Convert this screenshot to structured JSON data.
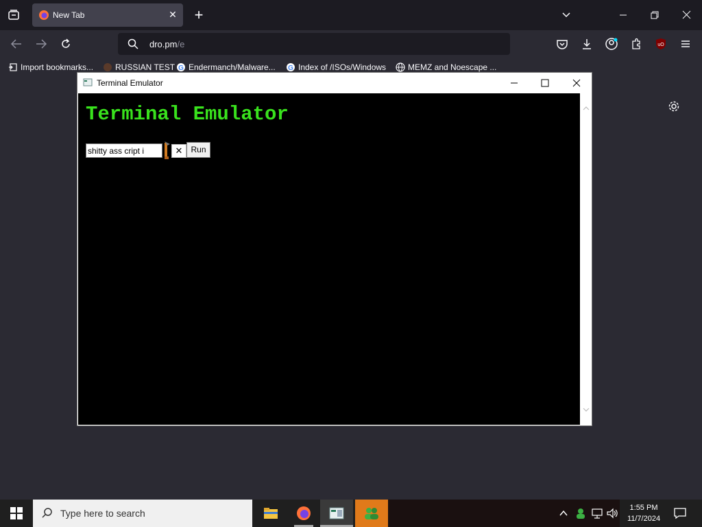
{
  "browser": {
    "tab_title": "New Tab",
    "url_main": "dro.pm",
    "url_suffix": "/e",
    "bookmarks": [
      {
        "label": "Import bookmarks..."
      },
      {
        "label": "RUSSIAN TEST"
      },
      {
        "label": "Endermanch/Malware..."
      },
      {
        "label": "Index of /ISOs/Windows"
      },
      {
        "label": "MEMZ and Noescape ..."
      }
    ]
  },
  "terminal": {
    "window_title": "Terminal Emulator",
    "heading": "Terminal Emulator",
    "input_value": "shitty ass cript i",
    "clear_label": "✕",
    "run_label": "Run"
  },
  "taskbar": {
    "search_placeholder": "Type here to search",
    "time": "1:55 PM",
    "date": "11/7/2024"
  },
  "colors": {
    "terminal_green": "#39e21d",
    "browser_dark": "#1c1b22",
    "browser_mid": "#2b2a33"
  }
}
